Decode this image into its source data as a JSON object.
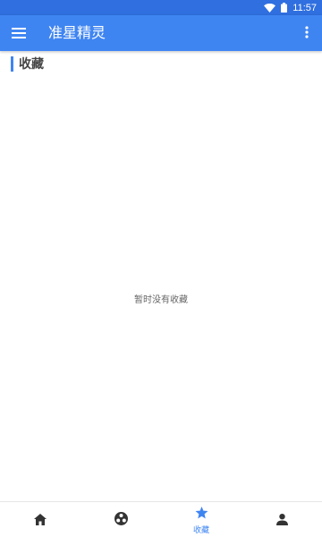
{
  "status_bar": {
    "time": "11:57",
    "icons": [
      "wifi-icon",
      "battery-icon"
    ]
  },
  "app_bar": {
    "title": "准星精灵",
    "left_icon": "menu-icon",
    "right_icon": "more-vert-icon"
  },
  "section": {
    "title": "收藏"
  },
  "empty_state": {
    "message": "暂时没有收藏"
  },
  "bottom_nav": {
    "items": [
      {
        "icon": "home-icon",
        "label": "",
        "active": false
      },
      {
        "icon": "game-icon",
        "label": "",
        "active": false
      },
      {
        "icon": "star-icon",
        "label": "收藏",
        "active": true
      },
      {
        "icon": "person-icon",
        "label": "",
        "active": false
      }
    ]
  },
  "colors": {
    "primary": "#3f85f2",
    "status_bar": "#2f6fe0",
    "background": "#ffffff"
  }
}
